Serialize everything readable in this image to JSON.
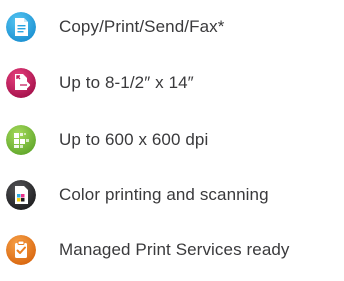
{
  "features": [
    {
      "icon": "document-icon",
      "label": "Copy/Print/Send/Fax*",
      "color": "#2aa5e2"
    },
    {
      "icon": "page-size-icon",
      "label": "Up to 8-1/2″ x 14″",
      "color": "#c4195a"
    },
    {
      "icon": "resolution-icon",
      "label": "Up to 600 x 600 dpi",
      "color": "#7dbf3b"
    },
    {
      "icon": "color-printing-icon",
      "label": "Color printing and scanning",
      "color": "#2b2b2d"
    },
    {
      "icon": "managed-print-icon",
      "label": "Managed Print Services ready",
      "color": "#ea7d1e"
    }
  ]
}
